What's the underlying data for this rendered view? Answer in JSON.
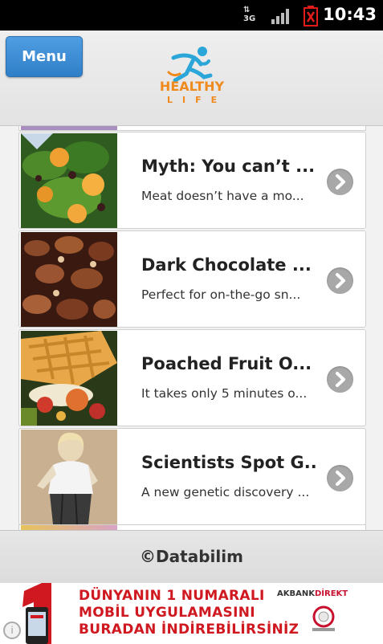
{
  "status_bar": {
    "network": "3G",
    "time": "10:43"
  },
  "header": {
    "menu_label": "Menu",
    "logo_line1": "HEALTHY",
    "logo_line2": "LIFE"
  },
  "articles": [
    {
      "title": "Myth: You can’t ...",
      "desc": "Meat doesn’t have a mo..."
    },
    {
      "title": "Dark Chocolate ...",
      "desc": "Perfect for on-the-go sn..."
    },
    {
      "title": "Poached Fruit O...",
      "desc": "It takes only 5 minutes o..."
    },
    {
      "title": "Scientists Spot G...",
      "desc": "A new genetic discovery ..."
    }
  ],
  "footer": {
    "copyright": "©Databilim"
  },
  "ad": {
    "line1": "DÜNYANIN 1 NUMARALI",
    "line2": "MOBİL UYGULAMASINI",
    "line3": "BURADAN İNDİREBİLİRSİNİZ",
    "brand_main": "AKBANK",
    "brand_accent": "DİREKT",
    "info_glyph": "i"
  },
  "colors": {
    "menu_button": "#3a8bd6",
    "logo_orange": "#f08a1c",
    "logo_blue": "#2aa6d8",
    "ad_red": "#d01820"
  }
}
